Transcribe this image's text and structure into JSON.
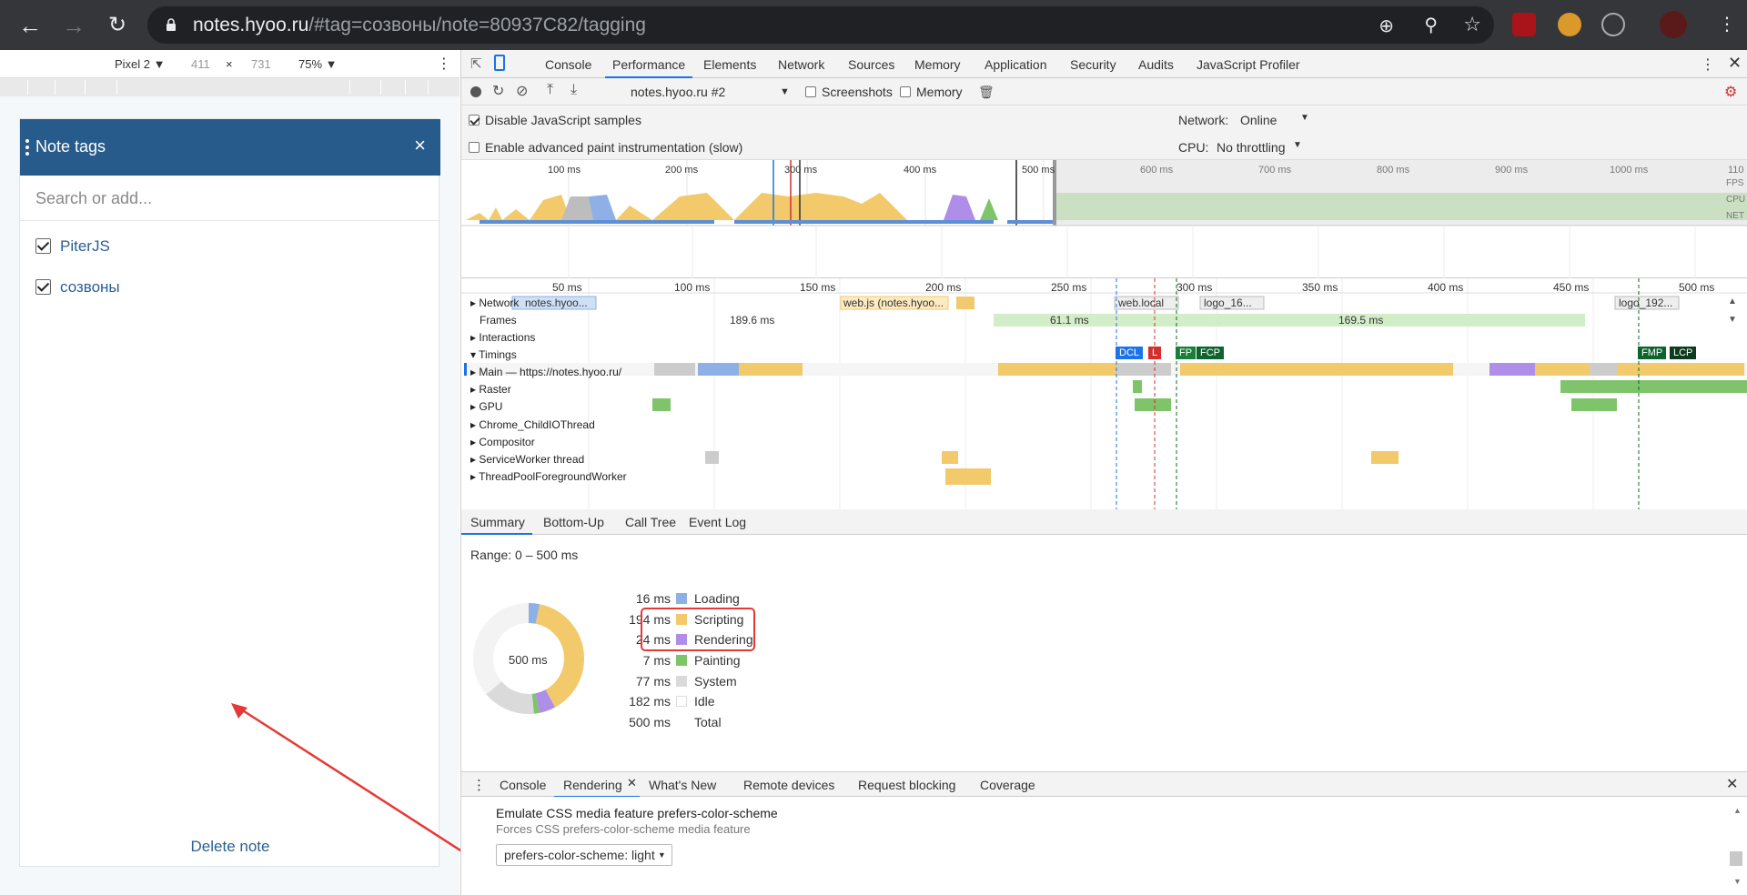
{
  "browser": {
    "url_host": "notes.hyoo.ru",
    "url_rest": "/#tag=созвоны/note=80937C82/tagging"
  },
  "device_toolbar": {
    "device": "Pixel 2 ▼",
    "width": "411",
    "times": "×",
    "height": "731",
    "zoom": "75% ▼"
  },
  "dialog": {
    "title": "Note tags",
    "close": "×",
    "search_placeholder": "Search or add...",
    "tags": [
      {
        "label": "PiterJS",
        "checked": true
      },
      {
        "label": "созвоны",
        "checked": true
      }
    ],
    "delete": "Delete note"
  },
  "devtools": {
    "tabs": [
      "Console",
      "Performance",
      "Elements",
      "Network",
      "Sources",
      "Memory",
      "Application",
      "Security",
      "Audits",
      "JavaScript Profiler"
    ],
    "active_tab": "Performance",
    "toolbar": {
      "profile": "notes.hyoo.ru #2",
      "screenshots": "Screenshots",
      "memory": "Memory"
    },
    "settings": {
      "disable_js_samples": "Disable JavaScript samples",
      "advanced_paint": "Enable advanced paint instrumentation (slow)",
      "network_label": "Network:",
      "network_value": "Online",
      "cpu_label": "CPU:",
      "cpu_value": "No throttling"
    },
    "overview_ticks": [
      "100 ms",
      "200 ms",
      "300 ms",
      "400 ms",
      "500 ms",
      "600 ms",
      "700 ms",
      "800 ms",
      "900 ms",
      "1000 ms",
      "110"
    ],
    "overview_labels": [
      "FPS",
      "CPU",
      "NET"
    ],
    "flame_ticks": [
      "50 ms",
      "100 ms",
      "150 ms",
      "200 ms",
      "250 ms",
      "300 ms",
      "350 ms",
      "400 ms",
      "450 ms",
      "500 ms"
    ],
    "tracks": {
      "network": "Network",
      "frames": "Frames",
      "interactions": "Interactions",
      "timings": "Timings",
      "main": "Main — https://notes.hyoo.ru/",
      "raster": "Raster",
      "gpu": "GPU",
      "child_io": "Chrome_ChildIOThread",
      "compositor": "Compositor",
      "sw": "ServiceWorker thread",
      "pool": "ThreadPoolForegroundWorker"
    },
    "network_items": [
      "notes.hyoo...",
      "web.js (notes.hyoo...",
      "web.local",
      "logo_16...",
      "logo_192..."
    ],
    "frames": [
      "189.6 ms",
      "61.1 ms",
      "169.5 ms"
    ],
    "timing_markers": [
      "DCL",
      "L",
      "FP",
      "FCP",
      "FMP",
      "LCP"
    ],
    "summary_tabs": [
      "Summary",
      "Bottom-Up",
      "Call Tree",
      "Event Log"
    ],
    "range": "Range: 0 – 500 ms",
    "donut_center": "500 ms",
    "legend": [
      {
        "value": "16 ms",
        "label": "Loading",
        "color": "#8fb0e6"
      },
      {
        "value": "194 ms",
        "label": "Scripting",
        "color": "#f2c96b"
      },
      {
        "value": "24 ms",
        "label": "Rendering",
        "color": "#ae8ee8"
      },
      {
        "value": "7 ms",
        "label": "Painting",
        "color": "#7fc46b"
      },
      {
        "value": "77 ms",
        "label": "System",
        "color": "#dadada"
      },
      {
        "value": "182 ms",
        "label": "Idle",
        "color": "#ffffff"
      },
      {
        "value": "500 ms",
        "label": "Total",
        "color": ""
      }
    ],
    "drawer_tabs": [
      "Console",
      "Rendering",
      "What's New",
      "Remote devices",
      "Request blocking",
      "Coverage"
    ],
    "drawer_active": "Rendering",
    "emulate_title": "Emulate CSS media feature prefers-color-scheme",
    "emulate_desc": "Forces CSS prefers-color-scheme media feature",
    "emulate_value": "prefers-color-scheme: light"
  }
}
